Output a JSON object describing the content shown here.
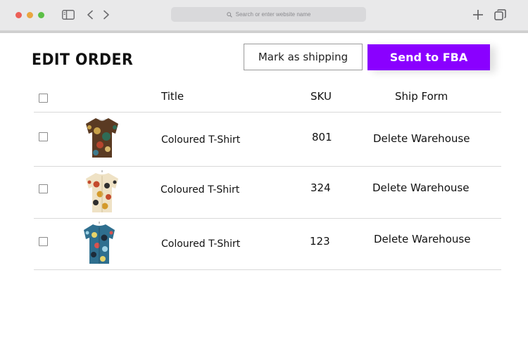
{
  "browser": {
    "address_placeholder": "Search or enter website name"
  },
  "page": {
    "title": "EDIT ORDER"
  },
  "actions": {
    "mark_shipping_label": "Mark as shipping",
    "send_fba_label": "Send to FBA",
    "accent_color": "#8a00ff"
  },
  "table": {
    "headers": {
      "title": "Title",
      "sku": "SKU",
      "ship_form": "Ship Form"
    },
    "rows": [
      {
        "title": "Coloured T-Shirt",
        "sku": "801",
        "ship_form": "Delete Warehouse",
        "image_icon": "paisley-tshirt-icon"
      },
      {
        "title": "Coloured T-Shirt",
        "sku": "324",
        "ship_form": "Delete Warehouse",
        "image_icon": "floral-shirt-icon"
      },
      {
        "title": "Coloured T-Shirt",
        "sku": "123",
        "ship_form": "Delete Warehouse",
        "image_icon": "blue-print-shirt-icon"
      }
    ]
  }
}
